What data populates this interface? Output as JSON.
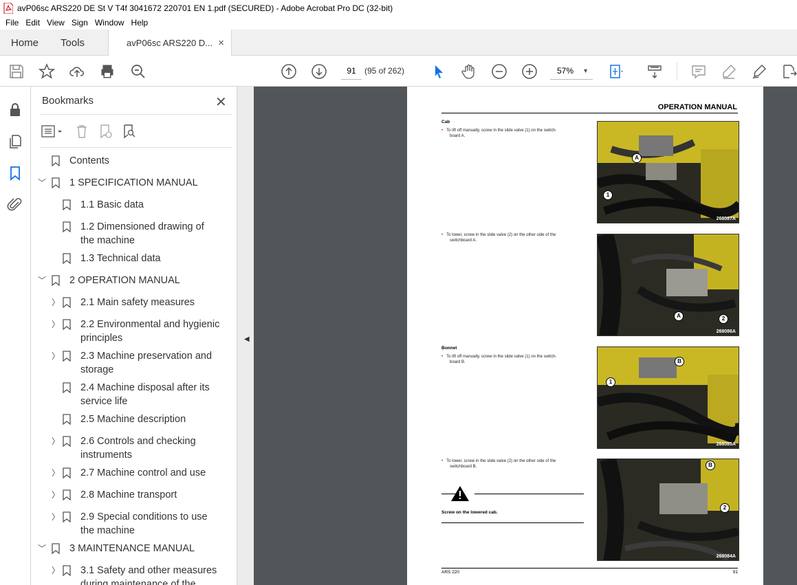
{
  "window": {
    "title": "avP06sc ARS220 DE St V T4f 3041672 220701 EN 1.pdf (SECURED) - Adobe Acrobat Pro DC (32-bit)"
  },
  "menu": [
    "File",
    "Edit",
    "View",
    "Sign",
    "Window",
    "Help"
  ],
  "tabs": {
    "home": "Home",
    "tools": "Tools",
    "doc": "avP06sc ARS220 D...",
    "close": "×"
  },
  "toolbar": {
    "page_number": "91",
    "page_count": "(95 of 262)",
    "zoom": "57%"
  },
  "bookmarks": {
    "title": "Bookmarks",
    "close": "✕",
    "items": [
      {
        "label": "Contents"
      },
      {
        "label": "1 SPECIFICATION MANUAL"
      },
      {
        "label": "1.1 Basic data"
      },
      {
        "label": "1.2 Dimensioned drawing of",
        "label2": "the machine"
      },
      {
        "label": "1.3 Technical data"
      },
      {
        "label": "2 OPERATION MANUAL"
      },
      {
        "label": "2.1 Main safety measures"
      },
      {
        "label": "2.2 Environmental and hygienic",
        "label2": "principles"
      },
      {
        "label": "2.3 Machine preservation and",
        "label2": "storage"
      },
      {
        "label": "2.4 Machine disposal after its",
        "label2": "service life"
      },
      {
        "label": "2.5 Machine description"
      },
      {
        "label": "2.6 Controls and checking",
        "label2": "instruments"
      },
      {
        "label": "2.7 Machine control and use"
      },
      {
        "label": "2.8 Machine transport"
      },
      {
        "label": "2.9 Special conditions to use",
        "label2": "the machine"
      },
      {
        "label": "3 MAINTENANCE MANUAL"
      },
      {
        "label": "3.1 Safety and other measures",
        "label2": "during maintenance of the"
      }
    ]
  },
  "page": {
    "header": "OPERATION MANUAL",
    "sec_cab": "Cab",
    "cab_1a": "To lift off manually, screw in the slide valve (1) on the switch-",
    "cab_1b": "board A.",
    "cab_2a": "To lower, screw in the slide valve (2) on the other side of the",
    "cab_2b": "switchboard A.",
    "sec_bonnet": "Bonnet",
    "bon_1a": "To lift off manually, screw in the slide valve (1) on the switch-",
    "bon_1b": "board B.",
    "bon_2a": "To lower, screw in the slide valve (2) on the other side of the",
    "bon_2b": "switchboard B.",
    "warning": "Screw on the lowered cab.",
    "photo_ids": [
      "268087A",
      "268086A",
      "268085A",
      "268084A"
    ],
    "callouts": {
      "a": "A",
      "b": "B",
      "one": "1",
      "two": "2"
    },
    "footer_left": "ARS 220",
    "footer_right": "91"
  }
}
